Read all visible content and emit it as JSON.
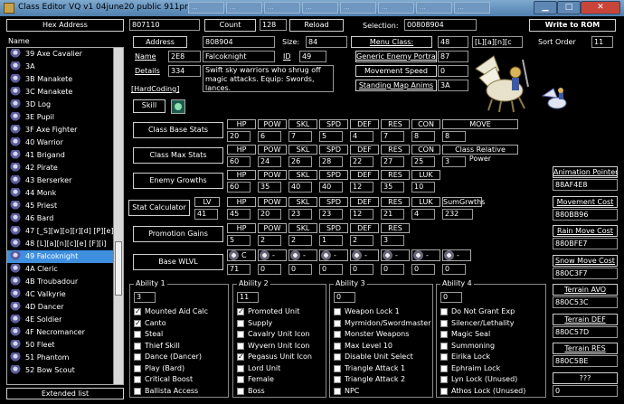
{
  "window": {
    "title": "Class Editor VQ v1 04june20 public 911pm.gba",
    "ghost_tabs": [
      "...",
      "...",
      "...",
      "...",
      "...",
      "...",
      "...",
      "..."
    ]
  },
  "left": {
    "header_btn": "Hex Address",
    "name_label": "Name",
    "items": [
      "39 Axe Cavalier",
      "3A",
      "3B Manakete",
      "3C Manakete",
      "3D Log",
      "3E Pupil",
      "3F Axe Fighter",
      "40 Warrior",
      "41 Brigand",
      "42 Pirate",
      "43 Berserker",
      "44 Monk",
      "45 Priest",
      "46 Bard",
      "47 [_S][w][o][r][d] [P][e]",
      "48 [L][a][n][c][e] [F][i]",
      "49 Falcoknight",
      "4A Cleric",
      "4B Troubadour",
      "4C Valkyrie",
      "4D Dancer",
      "4E Soldier",
      "4F Necromancer",
      "50 Fleet",
      "51 Phantom",
      "52 Bow Scout"
    ],
    "selected_index": 16,
    "extended_btn": "Extended list"
  },
  "top": {
    "address_value": "807110",
    "count_label": "Count",
    "count_value": "128",
    "reload_btn": "Reload",
    "selection_label": "Selection:",
    "selection_value": "00808904",
    "write_btn": "Write to ROM"
  },
  "info": {
    "address_label": "Address",
    "address_value": "808904",
    "size_label": "Size:",
    "size_value": "84",
    "name_label": "Name",
    "name_hex": "2E8",
    "name_text": "Falcoknight",
    "id_label": "ID",
    "id_value": "49",
    "details_label": "Details",
    "details_hex": "334",
    "details_text": "Swift sky warriors who shrug off magic attacks. Equip: Swords, lances.",
    "hardcoding_label": "[HardCoding]",
    "skill_btn": "Skill"
  },
  "class_props": {
    "menu_class_label": "Menu Class:",
    "menu_class_value": "48",
    "menu_class_glyphs": "[L][a][n][c",
    "sort_order_label": "Sort Order",
    "sort_order_value": "11",
    "generic_portrait_label": "Generic Enemy Portrait",
    "generic_portrait_value": "87",
    "movement_speed_label": "Movement Speed",
    "movement_speed_value": "0",
    "standing_anims_label": "Standing Map Anims",
    "standing_anims_value": "3A"
  },
  "stats": {
    "base_label": "Class Base Stats",
    "base_headers": [
      "HP",
      "POW",
      "SKL",
      "SPD",
      "DEF",
      "RES",
      "CON",
      "MOVE"
    ],
    "base_values": [
      "20",
      "6",
      "7",
      "5",
      "4",
      "7",
      "8",
      "8"
    ],
    "max_label": "Class Max Stats",
    "max_headers": [
      "HP",
      "POW",
      "SKL",
      "SPD",
      "DEF",
      "RES",
      "CON",
      "Class Relative Power"
    ],
    "max_values": [
      "60",
      "24",
      "26",
      "28",
      "22",
      "27",
      "25",
      "3"
    ],
    "enemy_label": "Enemy Growths",
    "enemy_headers": [
      "HP",
      "POW",
      "SKL",
      "SPD",
      "DEF",
      "RES",
      "LUK"
    ],
    "enemy_values": [
      "60",
      "35",
      "40",
      "40",
      "12",
      "35",
      "10"
    ],
    "calc_label": "Stat Calculator",
    "lv_label": "LV",
    "lv_value": "41",
    "calc_headers": [
      "HP",
      "POW",
      "SKL",
      "SPD",
      "DEF",
      "RES",
      "LUK",
      "SumGrwths"
    ],
    "calc_values": [
      "45",
      "20",
      "23",
      "23",
      "12",
      "21",
      "4",
      "232"
    ],
    "promo_label": "Promotion Gains",
    "promo_headers": [
      "HP",
      "POW",
      "SKL",
      "SPD",
      "DEF",
      "RES"
    ],
    "promo_values": [
      "5",
      "2",
      "2",
      "1",
      "2",
      "3"
    ],
    "wlvl_label": "Base WLVL",
    "wlvl_ranks": [
      "C",
      "-",
      "-",
      "-",
      "-",
      "-",
      "-",
      "-"
    ],
    "wlvl_values": [
      "71",
      "0",
      "0",
      "0",
      "0",
      "0",
      "0",
      "0"
    ]
  },
  "abilities": [
    {
      "title": "Ability 1",
      "value": "3",
      "items": [
        {
          "label": "Mounted Aid Calc",
          "checked": true
        },
        {
          "label": "Canto",
          "checked": true
        },
        {
          "label": "Steal",
          "checked": false
        },
        {
          "label": "Thief Skill",
          "checked": false
        },
        {
          "label": "Dance (Dancer)",
          "checked": false
        },
        {
          "label": "Play (Bard)",
          "checked": false
        },
        {
          "label": "Critical Boost",
          "checked": false
        },
        {
          "label": "Ballista Access",
          "checked": false
        }
      ]
    },
    {
      "title": "Ability 2",
      "value": "11",
      "items": [
        {
          "label": "Promoted Unit",
          "checked": true
        },
        {
          "label": "Supply",
          "checked": false
        },
        {
          "label": "Cavalry Unit Icon",
          "checked": false
        },
        {
          "label": "Wyvern Unit Icon",
          "checked": false
        },
        {
          "label": "Pegasus Unit Icon",
          "checked": true
        },
        {
          "label": "Lord Unit",
          "checked": false
        },
        {
          "label": "Female",
          "checked": false
        },
        {
          "label": "Boss",
          "checked": false
        }
      ]
    },
    {
      "title": "Ability 3",
      "value": "0",
      "items": [
        {
          "label": "Weapon Lock 1",
          "checked": false
        },
        {
          "label": "Myrmidon/Swordmaster",
          "checked": false
        },
        {
          "label": "Monster Weapons",
          "checked": false
        },
        {
          "label": "Max Level 10",
          "checked": false
        },
        {
          "label": "Disable Unit Select",
          "checked": false
        },
        {
          "label": "Triangle Attack 1",
          "checked": false
        },
        {
          "label": "Triangle Attack 2",
          "checked": false
        },
        {
          "label": "NPC",
          "checked": false
        }
      ]
    },
    {
      "title": "Ability 4",
      "value": "0",
      "items": [
        {
          "label": "Do Not Grant Exp",
          "checked": false
        },
        {
          "label": "Silencer/Lethality",
          "checked": false
        },
        {
          "label": "Magic Seal",
          "checked": false
        },
        {
          "label": "Summoning",
          "checked": false
        },
        {
          "label": "Eirika Lock",
          "checked": false
        },
        {
          "label": "Ephraim Lock",
          "checked": false
        },
        {
          "label": "Lyn Lock (Unused)",
          "checked": false
        },
        {
          "label": "Athos Lock (Unused)",
          "checked": false
        }
      ]
    }
  ],
  "pointers": [
    {
      "label": "Animation Pointer",
      "value": "88AF4E8"
    },
    {
      "label": "Movement Cost",
      "value": "880BB96"
    },
    {
      "label": "Rain Move Cost",
      "value": "880BFE7"
    },
    {
      "label": "Snow Move Cost",
      "value": "880C3F7"
    },
    {
      "label": "Terrain AVO",
      "value": "880C53C"
    },
    {
      "label": "Terrain DEF",
      "value": "880C57D"
    },
    {
      "label": "Terrain RES",
      "value": "880C5BE"
    },
    {
      "label": "???",
      "value": "0"
    }
  ]
}
